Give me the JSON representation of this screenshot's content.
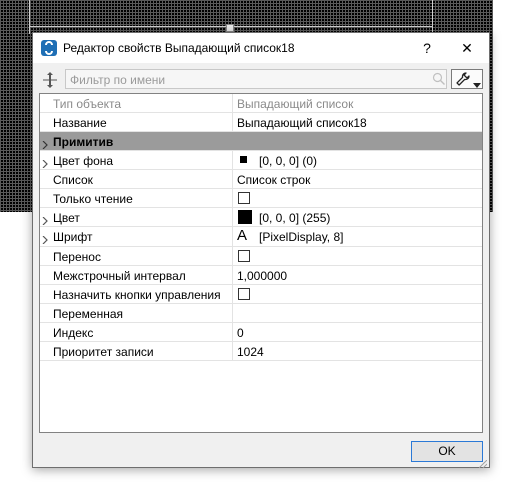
{
  "window": {
    "title": "Редактор свойств Выпадающий список18",
    "help_label": "?",
    "close_label": "✕"
  },
  "toolbar": {
    "filter_placeholder": "Фильтр по имени",
    "move_icon": "move-arrows-icon",
    "search_icon": "magnifier-icon",
    "tools_icon": "wrench-icon",
    "dropdown_icon": "chevron-down-icon"
  },
  "properties": {
    "type": {
      "name": "Тип объекта",
      "value": "Выпадающий список"
    },
    "title": {
      "name": "Название",
      "value": "Выпадающий список18"
    },
    "primitive": {
      "name": "Примитив"
    },
    "bg_color": {
      "name": "Цвет фона",
      "value": "[0, 0, 0] (0)",
      "swatch": "#000000"
    },
    "list": {
      "name": "Список",
      "value": "Список строк"
    },
    "read_only": {
      "name": "Только чтение",
      "checked": false
    },
    "color": {
      "name": "Цвет",
      "value": "[0, 0, 0] (255)",
      "swatch": "#000000"
    },
    "font": {
      "name": "Шрифт",
      "glyph": "A",
      "value": "[PixelDisplay, 8]"
    },
    "wrap": {
      "name": "Перенос",
      "checked": false
    },
    "line_spacing": {
      "name": "Межстрочный интервал",
      "value": "1,000000"
    },
    "nav_buttons": {
      "name": "Назначить кнопки управления",
      "checked": false
    },
    "variable": {
      "name": "Переменная",
      "value": ""
    },
    "index": {
      "name": "Индекс",
      "value": "0"
    },
    "priority": {
      "name": "Приоритет записи",
      "value": "1024"
    }
  },
  "footer": {
    "ok_label": "OK"
  },
  "colors": {
    "category_bg": "#9b9b9b",
    "ok_border": "#2b79d6",
    "app_icon": "#1f6fb5"
  }
}
